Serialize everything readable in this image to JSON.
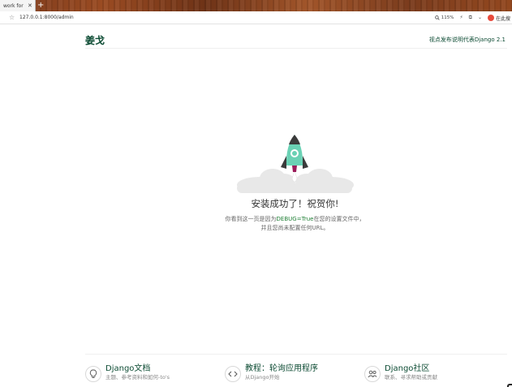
{
  "browser": {
    "tab_title": "work for",
    "tab_close": "✕",
    "new_tab": "+",
    "url": "127.0.0.1:8000/admin",
    "zoom": "115%",
    "extension_label": "在此搜"
  },
  "header": {
    "brand": "姜戈",
    "release_prefix": "视点",
    "release_link": "发布说明",
    "release_suffix": "代表Django 2.1"
  },
  "main": {
    "title": "安装成功了！祝贺你!",
    "desc_line1_a": "你看到这一页是因为",
    "desc_line1_hl": "DEBUG=True",
    "desc_line1_b": "在您的设置文件中，",
    "desc_line2": "并且您尚未配置任何URL。"
  },
  "footer": {
    "items": [
      {
        "title": "Django文档",
        "subtitle": "主题、参考资料和如何-to's",
        "icon": "lightbulb-icon"
      },
      {
        "title": "教程：轮询应用程序",
        "subtitle": "从Django开始",
        "icon": "code-icon"
      },
      {
        "title": "Django社区",
        "subtitle": "联系、寻求帮助或贡献",
        "icon": "people-icon"
      }
    ]
  },
  "colors": {
    "brand": "#0c4b33",
    "rocket": "#6ad1b4",
    "debug_highlight": "#1e7e34"
  }
}
